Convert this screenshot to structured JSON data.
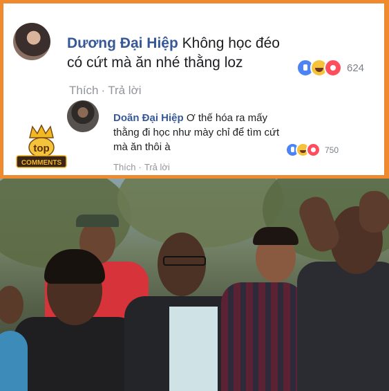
{
  "comment1": {
    "author": "Dương Đại Hiệp",
    "text": "Không học đéo có cứt mà ăn nhé thằng loz",
    "reaction_count": "624",
    "actions": {
      "like": "Thích",
      "reply": "Trả lời",
      "separator": "·"
    }
  },
  "comment2": {
    "author": "Doãn Đại Hiệp",
    "text": "Ơ thế hóa ra mấy thằng đi học như mày chỉ để tìm cứt mà ăn thôi à",
    "reaction_count": "750",
    "actions": {
      "like": "Thích",
      "reply": "Trả lời",
      "separator": "·"
    }
  },
  "badge": {
    "line1": "top",
    "line2": "COMMENTS"
  },
  "colors": {
    "frame": "#f08a2c",
    "author": "#365899",
    "muted": "#90949c",
    "like": "#4c84f5",
    "haha": "#f5c33b",
    "wow": "#ff4f5f"
  },
  "icons": [
    "like-reaction-icon",
    "haha-reaction-icon",
    "wow-reaction-icon",
    "crown-icon"
  ]
}
